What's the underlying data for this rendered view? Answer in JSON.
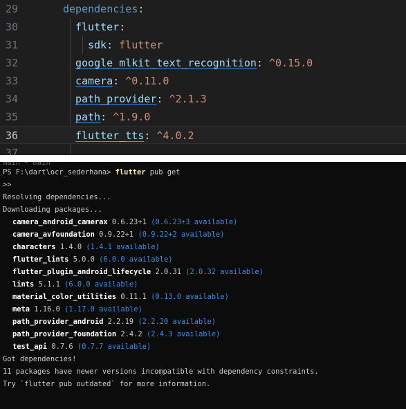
{
  "editor": {
    "lines": [
      {
        "num": "29",
        "parts": [
          {
            "t": "dependencies",
            "c": "k1"
          },
          {
            "t": ":",
            "c": "plain"
          }
        ]
      },
      {
        "num": "30",
        "parts": [
          {
            "t": "flutter",
            "c": "k2"
          },
          {
            "t": ":",
            "c": "plain"
          }
        ]
      },
      {
        "num": "31",
        "parts": [
          {
            "t": "sdk",
            "c": "k2"
          },
          {
            "t": ": ",
            "c": "plain"
          },
          {
            "t": "flutter",
            "c": "k3"
          }
        ]
      },
      {
        "num": "32",
        "parts": [
          {
            "t": "google_mlkit_text_recognition",
            "c": "k2 under"
          },
          {
            "t": ": ",
            "c": "plain"
          },
          {
            "t": "^0.15.0",
            "c": "k3"
          }
        ]
      },
      {
        "num": "33",
        "parts": [
          {
            "t": "camera",
            "c": "k2 under"
          },
          {
            "t": ": ",
            "c": "plain"
          },
          {
            "t": "^0.11.0",
            "c": "k3"
          }
        ]
      },
      {
        "num": "34",
        "parts": [
          {
            "t": "path_provider",
            "c": "k2 under"
          },
          {
            "t": ": ",
            "c": "plain"
          },
          {
            "t": "^2.1.3",
            "c": "k3"
          }
        ]
      },
      {
        "num": "35",
        "parts": [
          {
            "t": "path",
            "c": "k2 under"
          },
          {
            "t": ": ",
            "c": "plain"
          },
          {
            "t": "^1.9.0",
            "c": "k3"
          }
        ]
      },
      {
        "num": "36",
        "parts": [
          {
            "t": "flutter_tts",
            "c": "k2 under"
          },
          {
            "t": ": ",
            "c": "plain"
          },
          {
            "t": "^4.0.2",
            "c": "k3"
          }
        ]
      },
      {
        "num": "37",
        "parts": []
      }
    ]
  },
  "terminal": {
    "clipped_top": "main ~ main",
    "prompt": "PS F:\\dart\\ocr_sederhana>",
    "command": "flutter",
    "command_args": "pub get",
    "continuation": ">>",
    "resolving": "Resolving dependencies...",
    "downloading": "Downloading packages...",
    "packages": [
      {
        "name": "camera_android_camerax",
        "version": "0.6.23+1",
        "available": "(0.6.23+3 available)"
      },
      {
        "name": "camera_avfoundation",
        "version": "0.9.22+1",
        "available": "(0.9.22+2 available)"
      },
      {
        "name": "characters",
        "version": "1.4.0",
        "available": "(1.4.1 available)"
      },
      {
        "name": "flutter_lints",
        "version": "5.0.0",
        "available": "(6.0.0 available)"
      },
      {
        "name": "flutter_plugin_android_lifecycle",
        "version": "2.0.31",
        "available": "(2.0.32 available)"
      },
      {
        "name": "lints",
        "version": "5.1.1",
        "available": "(6.0.0 available)"
      },
      {
        "name": "material_color_utilities",
        "version": "0.11.1",
        "available": "(0.13.0 available)"
      },
      {
        "name": "meta",
        "version": "1.16.0",
        "available": "(1.17.0 available)"
      },
      {
        "name": "path_provider_android",
        "version": "2.2.19",
        "available": "(2.2.20 available)"
      },
      {
        "name": "path_provider_foundation",
        "version": "2.4.2",
        "available": "(2.4.3 available)"
      },
      {
        "name": "test_api",
        "version": "0.7.6",
        "available": "(0.7.7 available)"
      }
    ],
    "got": "Got dependencies!",
    "summary": "11 packages have newer versions incompatible with dependency constraints.",
    "hint": "Try `flutter pub outdated` for more information."
  },
  "colors": {
    "editor_bg": "#1e1e1e",
    "terminal_bg": "#0c0c0c",
    "key": "#9cdcfe",
    "value": "#ce9178",
    "available": "#3b8eea"
  }
}
